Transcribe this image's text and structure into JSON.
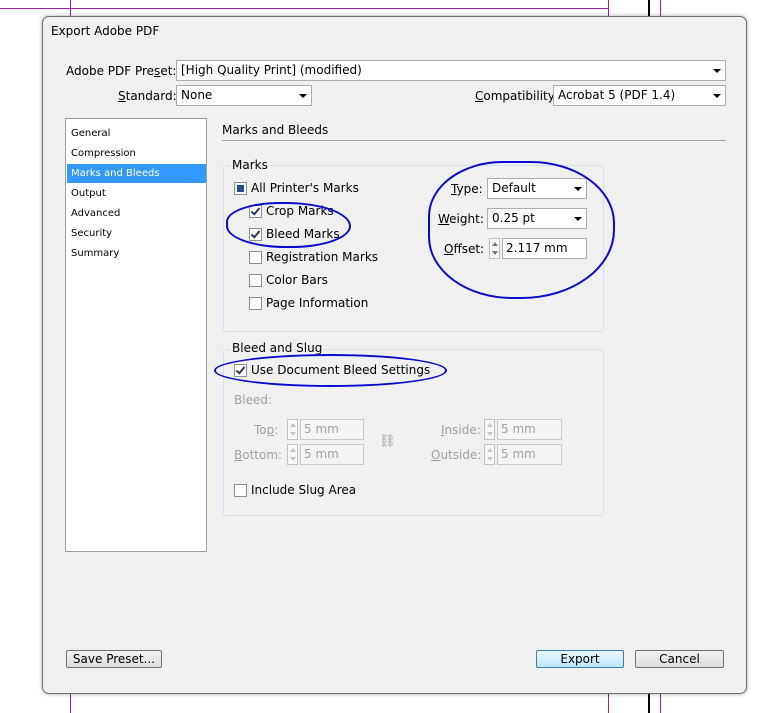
{
  "window": {
    "title": "Export Adobe PDF"
  },
  "preset": {
    "label": "Adobe PDF Preset:",
    "value": "[High Quality Print] (modified)"
  },
  "standard": {
    "label": "Standard:",
    "value": "None"
  },
  "compatibility": {
    "label": "Compatibility:",
    "value": "Acrobat 5 (PDF 1.4)"
  },
  "nav": {
    "items": [
      {
        "label": "General"
      },
      {
        "label": "Compression"
      },
      {
        "label": "Marks and Bleeds",
        "selected": true
      },
      {
        "label": "Output"
      },
      {
        "label": "Advanced"
      },
      {
        "label": "Security"
      },
      {
        "label": "Summary"
      }
    ]
  },
  "panel": {
    "heading": "Marks and Bleeds"
  },
  "marks": {
    "legend": "Marks",
    "all_printers": {
      "label": "All Printer's Marks",
      "state": "indeterminate"
    },
    "crop": {
      "label": "Crop Marks",
      "checked": true
    },
    "bleed": {
      "label": "Bleed Marks",
      "checked": true
    },
    "registration": {
      "label": "Registration Marks",
      "checked": false
    },
    "color_bars": {
      "label": "Color Bars",
      "checked": false
    },
    "page_info": {
      "label": "Page Information",
      "checked": false
    },
    "type": {
      "label": "Type:",
      "value": "Default"
    },
    "weight": {
      "label": "Weight:",
      "value": "0.25 pt"
    },
    "offset": {
      "label": "Offset:",
      "value": "2.117 mm"
    }
  },
  "bleed_slug": {
    "legend": "Bleed and Slug",
    "use_doc": {
      "label": "Use Document Bleed Settings",
      "checked": true
    },
    "bleed_label": "Bleed:",
    "top": {
      "label": "Top:",
      "value": "5 mm"
    },
    "bottom": {
      "label": "Bottom:",
      "value": "5 mm"
    },
    "inside": {
      "label": "Inside:",
      "value": "5 mm"
    },
    "outside": {
      "label": "Outside:",
      "value": "5 mm"
    },
    "include_slug": {
      "label": "Include Slug Area",
      "checked": false
    }
  },
  "buttons": {
    "save_preset": "Save Preset...",
    "export": "Export",
    "cancel": "Cancel"
  },
  "colors": {
    "selection": "#3399ff",
    "annotation_ink": "#0a0ad0",
    "guide": "#a020a0"
  }
}
